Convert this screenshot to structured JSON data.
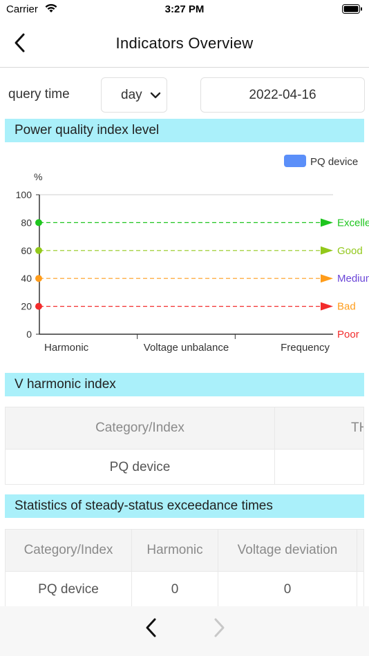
{
  "status_bar": {
    "carrier": "Carrier",
    "time": "3:27 PM"
  },
  "nav": {
    "title": "Indicators Overview"
  },
  "query": {
    "label": "query time",
    "period": "day",
    "date": "2022-04-16"
  },
  "sections": {
    "pq_level": "Power quality index level",
    "v_harmonic": "V harmonic index",
    "steady_status": "Statistics of steady-status exceedance times"
  },
  "chart_data": {
    "type": "line",
    "ylabel": "%",
    "ylim": [
      0,
      100
    ],
    "y_ticks": [
      "0",
      "20",
      "40",
      "60",
      "80",
      "100"
    ],
    "categories": [
      "Harmonic",
      "Voltage unbalance",
      "Frequency"
    ],
    "legend": {
      "label": "PQ device",
      "color": "#5b8ff9",
      "position": "top-right"
    },
    "grid": false,
    "levels": [
      {
        "label": "Excellent",
        "value": 80,
        "color": "#1ec51e"
      },
      {
        "label": "Good",
        "value": 60,
        "color": "#92c81a"
      },
      {
        "label": "Medium",
        "value": 40,
        "color": "#ff9c1a"
      },
      {
        "label": "Bad",
        "value": 20,
        "color": "#f22c2c"
      },
      {
        "label": "Poor",
        "value": 0,
        "color": "#f22c2c"
      }
    ],
    "level_label_colors": {
      "Excellent": "#1ec51e",
      "Good": "#92c81a",
      "Medium": "#6a45d8",
      "Bad": "#ff9c1a",
      "Poor": "#f22c2c"
    },
    "series": [
      {
        "name": "PQ device",
        "values": []
      }
    ]
  },
  "v_harmonic_table": {
    "headers": [
      "Category/Index",
      "THD"
    ],
    "rows": [
      [
        "PQ device",
        ""
      ]
    ]
  },
  "steady_table": {
    "headers": [
      "Category/Index",
      "Harmonic",
      "Voltage deviation",
      ""
    ],
    "rows": [
      [
        "PQ device",
        "0",
        "0",
        ""
      ]
    ]
  },
  "icons": {
    "back": "chevron-left-icon",
    "prev": "chevron-left-icon",
    "next": "chevron-right-icon",
    "dropdown": "chevron-down-icon"
  },
  "colors": {
    "section_bg": "#aaf0fa",
    "legend": "#5b8ff9"
  }
}
